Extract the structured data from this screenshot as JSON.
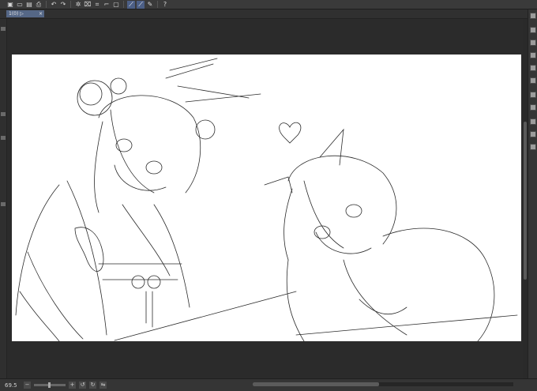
{
  "toolbar": {
    "buttons": [
      {
        "name": "new-canvas-icon",
        "glyph": "▣"
      },
      {
        "name": "open-file-icon",
        "glyph": "▭"
      },
      {
        "name": "save-icon",
        "glyph": "▤"
      },
      {
        "name": "print-icon",
        "glyph": "⎙"
      },
      {
        "name": "undo-icon",
        "glyph": "↶"
      },
      {
        "name": "redo-icon",
        "glyph": "↷"
      },
      {
        "name": "loading-icon",
        "glyph": "✲"
      },
      {
        "name": "clear-icon",
        "glyph": "⌧"
      },
      {
        "name": "transform-icon",
        "glyph": "⌗"
      },
      {
        "name": "crop-icon",
        "glyph": "⌐"
      },
      {
        "name": "selection-icon",
        "glyph": "▢"
      },
      {
        "name": "snap-ruler-icon",
        "glyph": "⟋"
      },
      {
        "name": "snap-special-icon",
        "glyph": "⟋"
      },
      {
        "name": "pen-icon",
        "glyph": "✎"
      },
      {
        "name": "help-icon",
        "glyph": "?"
      }
    ]
  },
  "document_tab": {
    "label": "1(0) ▷",
    "close": "×"
  },
  "status": {
    "zoom": "69.5"
  },
  "colors": {
    "accent": "#556786",
    "canvas": "#ffffff",
    "workspace": "#2b2b2b"
  }
}
